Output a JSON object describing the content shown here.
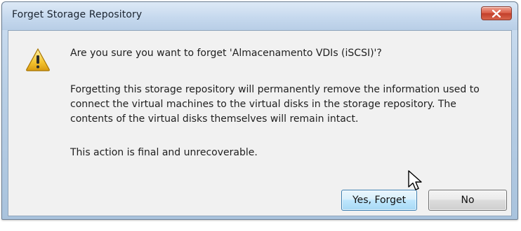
{
  "window": {
    "title": "Forget Storage Repository",
    "close_icon": "close-icon"
  },
  "message": {
    "icon": "warning-icon",
    "question": "Are you sure you want to forget 'Almacenamento VDIs (iSCSI)'?",
    "detail": "Forgetting this storage repository will permanently remove the information used to connect the virtual machines to the virtual disks in the storage repository. The contents of the virtual disks themselves will remain intact.",
    "final": "This action is final and unrecoverable."
  },
  "buttons": {
    "yes_label": "Yes, Forget",
    "no_label": "No"
  },
  "colors": {
    "warning_yellow": "#f4c430",
    "close_red": "#d0503a",
    "button_accent": "#3c7fb1"
  }
}
